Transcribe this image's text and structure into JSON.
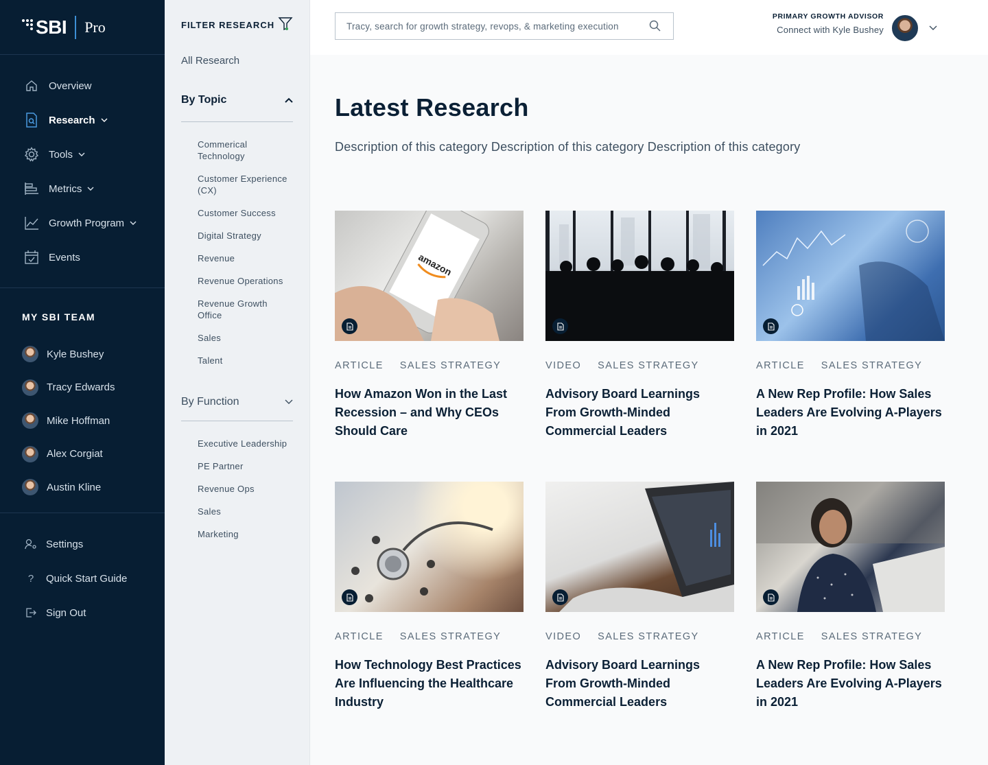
{
  "brand": {
    "name": "SBI",
    "product": "Pro"
  },
  "nav": {
    "items": [
      {
        "label": "Overview",
        "icon": "home-icon",
        "active": false,
        "has_chevron": false
      },
      {
        "label": "Research",
        "icon": "research-doc-icon",
        "active": true,
        "has_chevron": true
      },
      {
        "label": "Tools",
        "icon": "gear-icon",
        "active": false,
        "has_chevron": true
      },
      {
        "label": "Metrics",
        "icon": "bar-chart-icon",
        "active": false,
        "has_chevron": true
      },
      {
        "label": "Growth Program",
        "icon": "line-chart-icon",
        "active": false,
        "has_chevron": true
      },
      {
        "label": "Events",
        "icon": "calendar-icon",
        "active": false,
        "has_chevron": false
      }
    ],
    "team_title": "MY SBI TEAM",
    "team": [
      {
        "name": "Kyle Bushey"
      },
      {
        "name": "Tracy Edwards"
      },
      {
        "name": "Mike Hoffman"
      },
      {
        "name": "Alex Corgiat"
      },
      {
        "name": "Austin Kline"
      }
    ],
    "bottom": [
      {
        "label": "Settings",
        "icon": "user-settings-icon"
      },
      {
        "label": "Quick Start Guide",
        "icon": "question-icon"
      },
      {
        "label": "Sign Out",
        "icon": "sign-out-icon"
      }
    ]
  },
  "filter": {
    "title": "FILTER RESEARCH",
    "all_label": "All Research",
    "by_topic": {
      "label": "By Topic",
      "topics": [
        "Commerical Technology",
        "Customer Experience (CX)",
        "Customer Success",
        "Digital Strategy",
        "Revenue",
        "Revenue Operations",
        "Revenue Growth Office",
        "Sales",
        "Talent"
      ]
    },
    "by_function": {
      "label": "By Function",
      "functions": [
        "Executive Leadership",
        "PE Partner",
        "Revenue Ops",
        "Sales",
        "Marketing"
      ]
    }
  },
  "search": {
    "placeholder": "Tracy, search for growth strategy, revops, & marketing execution"
  },
  "advisor": {
    "label": "PRIMARY GROWTH ADVISOR",
    "link": "Connect with Kyle Bushey"
  },
  "main": {
    "title": "Latest Research",
    "description": "Description of this category Description of this category Description of this category"
  },
  "cards": [
    {
      "type": "ARTICLE",
      "category": "SALES STRATEGY",
      "title": "How Amazon Won in the Last Recession – and Why CEOs Should Care",
      "image": "phone-amazon-image"
    },
    {
      "type": "VIDEO",
      "category": "SALES STRATEGY",
      "title": "Advisory Board Learnings From Growth-Minded Commercial Leaders",
      "image": "boardroom-silhouette-image"
    },
    {
      "type": "ARTICLE",
      "category": "SALES STRATEGY",
      "title": "A New Rep Profile: How Sales Leaders Are Evolving A-Players in 2021",
      "image": "data-overlay-image"
    },
    {
      "type": "ARTICLE",
      "category": "SALES STRATEGY",
      "title": "How Technology Best Practices Are Influencing the Healthcare Industry",
      "image": "stethoscope-image"
    },
    {
      "type": "VIDEO",
      "category": "SALES STRATEGY",
      "title": "Advisory Board Learnings From Growth-Minded Commercial Leaders",
      "image": "laptop-desk-image"
    },
    {
      "type": "ARTICLE",
      "category": "SALES STRATEGY",
      "title": "A New Rep Profile: How Sales Leaders Are Evolving A-Players in 2021",
      "image": "woman-headset-image"
    }
  ]
}
